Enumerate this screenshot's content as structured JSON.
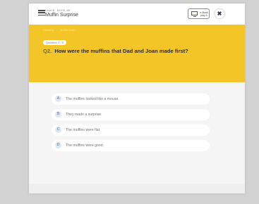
{
  "header": {
    "level": "Level B · BOOK 4/8",
    "title": "Muffin Surprise",
    "ebook_label": "e-Book\nplay it",
    "close_icon": "x-icon"
  },
  "banner": {
    "breadcrumbs": [
      "Reading",
      "Muffin Surp..."
    ],
    "question_chip": "Question 2 / 5",
    "question_number": "Q2.",
    "question_text": "How were the muffins that Dad and Joan made first?",
    "color": "#f3c527"
  },
  "options": [
    {
      "key": "A",
      "text": "The muffins looked like a mouse."
    },
    {
      "key": "B",
      "text": "They made a surprise."
    },
    {
      "key": "C",
      "text": "The muffins were flat."
    },
    {
      "key": "D",
      "text": "The muffins were good."
    }
  ]
}
